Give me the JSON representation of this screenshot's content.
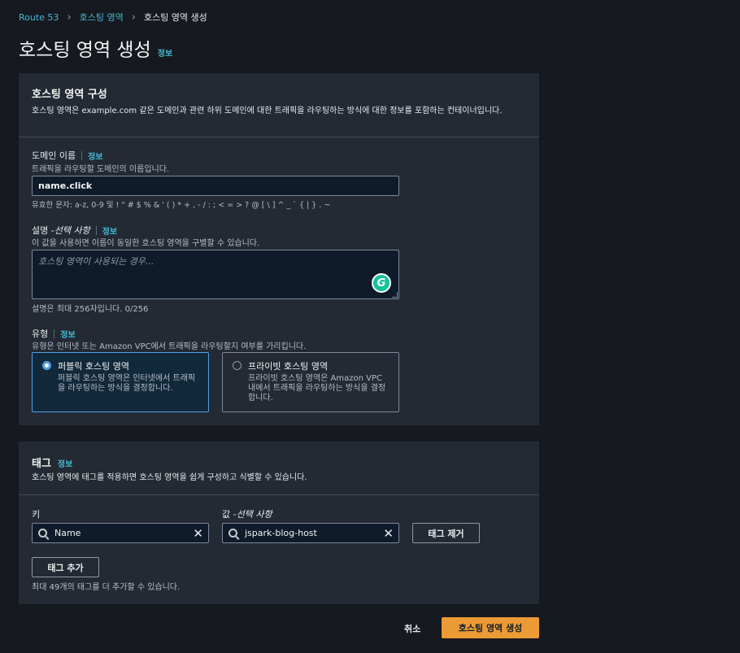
{
  "breadcrumb": {
    "root": "Route 53",
    "middle": "호스팅 영역",
    "current": "호스팅 영역 생성"
  },
  "page": {
    "title": "호스팅 영역 생성",
    "info": "정보"
  },
  "config": {
    "title": "호스팅 영역 구성",
    "description": "호스팅 영역은 example.com 같은 도메인과 관련 하위 도메인에 대한 트래픽을 라우팅하는 방식에 대한 정보를 포함하는 컨테이너입니다.",
    "domain": {
      "label": "도메인 이름",
      "info": "정보",
      "hint": "트래픽을 라우팅할 도메인의 이름입니다.",
      "value": "name.click",
      "constraint": "유효한 문자: a-z, 0-9 및 ! \" # $ % & ' ( ) * + , - / : ; < = > ? @ [ \\ ] ^ _ ` { | } . ~"
    },
    "description_field": {
      "label_main": "설명 - ",
      "label_optional": "선택 사항",
      "info": "정보",
      "hint": "이 값을 사용하면 이름이 동일한 호스팅 영역을 구별할 수 있습니다.",
      "placeholder": "호스팅 영역이 사용되는 경우...",
      "counter": "설명은 최대 256자입니다. 0/256"
    },
    "type": {
      "label": "유형",
      "info": "정보",
      "hint": "유형은 인터넷 또는 Amazon VPC에서 트래픽을 라우팅할지 여부를 가리킵니다.",
      "options": [
        {
          "title": "퍼블릭 호스팅 영역",
          "desc": "퍼블릭 호스팅 영역은 인터넷에서 트래픽을 라우팅하는 방식을 결정합니다.",
          "selected": true
        },
        {
          "title": "프라이빗 호스팅 영역",
          "desc": "프라이빗 호스팅 영역은 Amazon VPC 내에서 트래픽을 라우팅하는 방식을 결정합니다.",
          "selected": false
        }
      ]
    }
  },
  "tags": {
    "title": "태그",
    "info": "정보",
    "description": "호스팅 영역에 태그를 적용하면 호스팅 영역을 쉽게 구성하고 식별할 수 있습니다.",
    "key_label": "키",
    "value_label_main": "값 - ",
    "value_label_optional": "선택 사항",
    "key_value": "Name",
    "value_value": "jspark-blog-host",
    "remove_button": "태그 제거",
    "add_button": "태그 추가",
    "limit_hint": "최대 49개의 태그를 더 추가할 수 있습니다."
  },
  "footer": {
    "cancel": "취소",
    "submit": "호스팅 영역 생성"
  },
  "colors": {
    "background": "#16191f",
    "panel": "#232a33",
    "link": "#44b9d6",
    "primary": "#ec9a35",
    "selected_border": "#539fe5"
  },
  "icons": [
    "chevron-right-icon",
    "search-icon",
    "clear-icon",
    "grammarly-icon",
    "radio-icon"
  ]
}
